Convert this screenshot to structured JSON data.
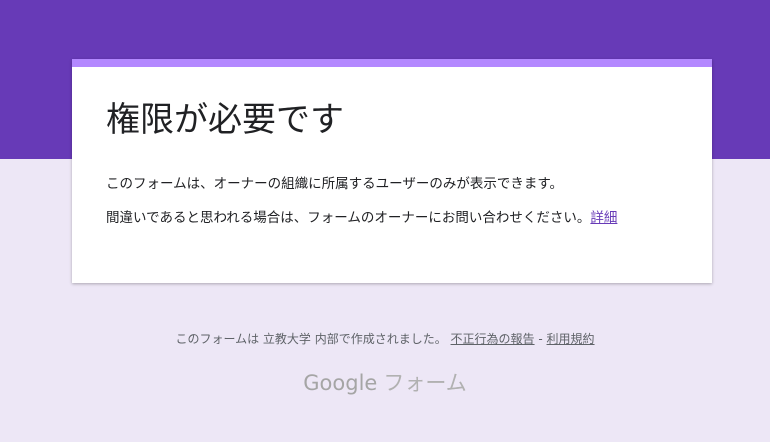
{
  "colors": {
    "header_band": "#673ab7",
    "card_accent": "#b388ff",
    "page_background": "#ede7f6",
    "card_background": "#ffffff",
    "link": "#673ab7"
  },
  "card": {
    "title": "権限が必要です",
    "message": "このフォームは、オーナーの組織に所属するユーザーのみが表示できます。",
    "contact_message": "間違いであると思われる場合は、フォームのオーナーにお問い合わせください。",
    "details_link": "詳細"
  },
  "footer": {
    "created_text": "このフォームは 立教大学 内部で作成されました。",
    "report_link": "不正行為の報告",
    "separator": " - ",
    "terms_link": "利用規約",
    "logo_brand": "Google",
    "logo_product": "フォーム"
  }
}
